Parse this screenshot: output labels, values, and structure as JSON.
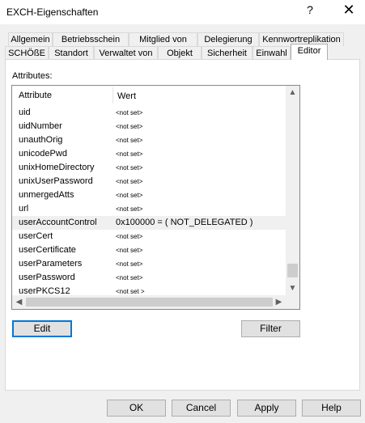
{
  "window": {
    "title": "EXCH-Eigenschaften",
    "help_glyph": "?",
    "close_glyph": "✕"
  },
  "tabs": {
    "row1": [
      "Allgemein",
      "Betriebsschein",
      "Mitglied von",
      "Delegierung",
      "Kennwortreplikation"
    ],
    "row2": [
      "SCHÖßE",
      "Standort",
      "Verwaltet von",
      "Objekt",
      "Sicherheit",
      "Einwahl"
    ],
    "active": "Editor"
  },
  "attributes_label": "Attributes:",
  "list": {
    "columns": {
      "attribute": "Attribute",
      "value": "Wert"
    },
    "rows": [
      {
        "name": "uid",
        "value": "<not set>"
      },
      {
        "name": "uidNumber",
        "value": "<not set>"
      },
      {
        "name": "unauthOrig",
        "value": "<not set>"
      },
      {
        "name": "unicodePwd",
        "value": "<not set>"
      },
      {
        "name": "unixHomeDirectory",
        "value": "<not set>"
      },
      {
        "name": "unixUserPassword",
        "value": "<not set>"
      },
      {
        "name": "unmergedAtts",
        "value": "<not set>"
      },
      {
        "name": "url",
        "value": "<not set>"
      },
      {
        "name": "userAccountControl",
        "value": "0x100000 = ( NOT_DELEGATED )"
      },
      {
        "name": "userCert",
        "value": "<not set>"
      },
      {
        "name": "userCertificate",
        "value": "<not set>"
      },
      {
        "name": "userParameters",
        "value": "<not set>"
      },
      {
        "name": "userPassword",
        "value": "<not set>"
      },
      {
        "name": "userPKCS12",
        "value": "<not set >"
      }
    ]
  },
  "buttons": {
    "edit": "Edit",
    "filter": "Filter",
    "ok": "OK",
    "cancel": "Cancel",
    "apply": "Apply",
    "help": "Help"
  },
  "colors": {
    "accent": "#0078d7",
    "selection": "#f0f0f0"
  }
}
